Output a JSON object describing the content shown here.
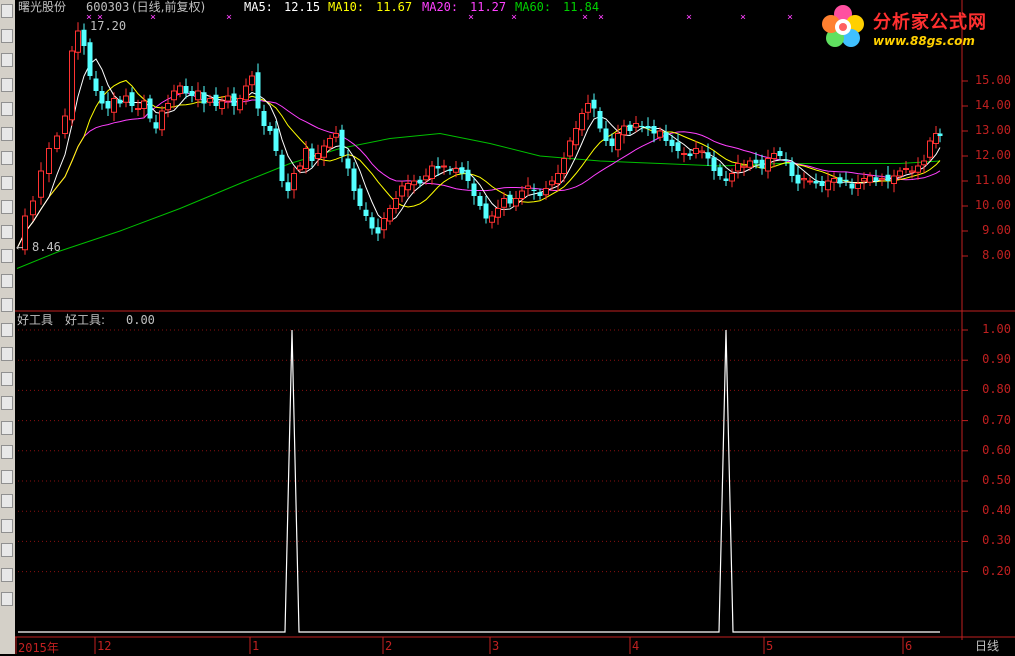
{
  "header": {
    "stock_name": "曙光股份",
    "stock_code": "600303",
    "mode": "(日线,前复权)",
    "ma5_label": "MA5:",
    "ma5_value": "12.15",
    "ma10_label": "MA10:",
    "ma10_value": "11.67",
    "ma20_label": "MA20:",
    "ma20_value": "11.27",
    "ma60_label": "MA60:",
    "ma60_value": "11.84"
  },
  "logo": {
    "title": "分析家公式网",
    "url": "www.88gs.com"
  },
  "price_chart": {
    "high_marker": "17.20",
    "low_marker": "8.46",
    "y_ticks": [
      "15.00",
      "14.00",
      "13.00",
      "12.00",
      "11.00",
      "10.00",
      "9.00",
      "8.00"
    ]
  },
  "indicator": {
    "title": "好工具",
    "value_label": "好工具:",
    "value": "0.00",
    "y_ticks": [
      "1.00",
      "0.90",
      "0.80",
      "0.70",
      "0.60",
      "0.50",
      "0.40",
      "0.30",
      "0.20"
    ]
  },
  "date_axis": {
    "labels": [
      "2015年",
      "12",
      "1",
      "2",
      "3",
      "4",
      "5",
      "6"
    ],
    "period_button": "日线"
  },
  "toolbar": {
    "icons": [
      "arrow-up-icon",
      "arrow-down-icon",
      "kline-icon",
      "volume-icon",
      "table-icon",
      "trend-icon",
      "macd-icon",
      "kdj-icon",
      "fund-icon",
      "info-icon",
      "f10-icon",
      "pie-icon",
      "clock-icon",
      "rsi-icon",
      "boll-icon",
      "move-icon",
      "draw-icon",
      "f5-icon",
      "layout-icon",
      "number-1",
      "number-5",
      "number-5b",
      "number-30",
      "number-60",
      "number-1b"
    ]
  },
  "colors": {
    "up": "#ff3232",
    "down": "#54ffff",
    "ma5": "#ffffff",
    "ma10": "#ffff00",
    "ma20": "#ff40ff",
    "ma60": "#00c000",
    "axis": "#c02020"
  }
}
